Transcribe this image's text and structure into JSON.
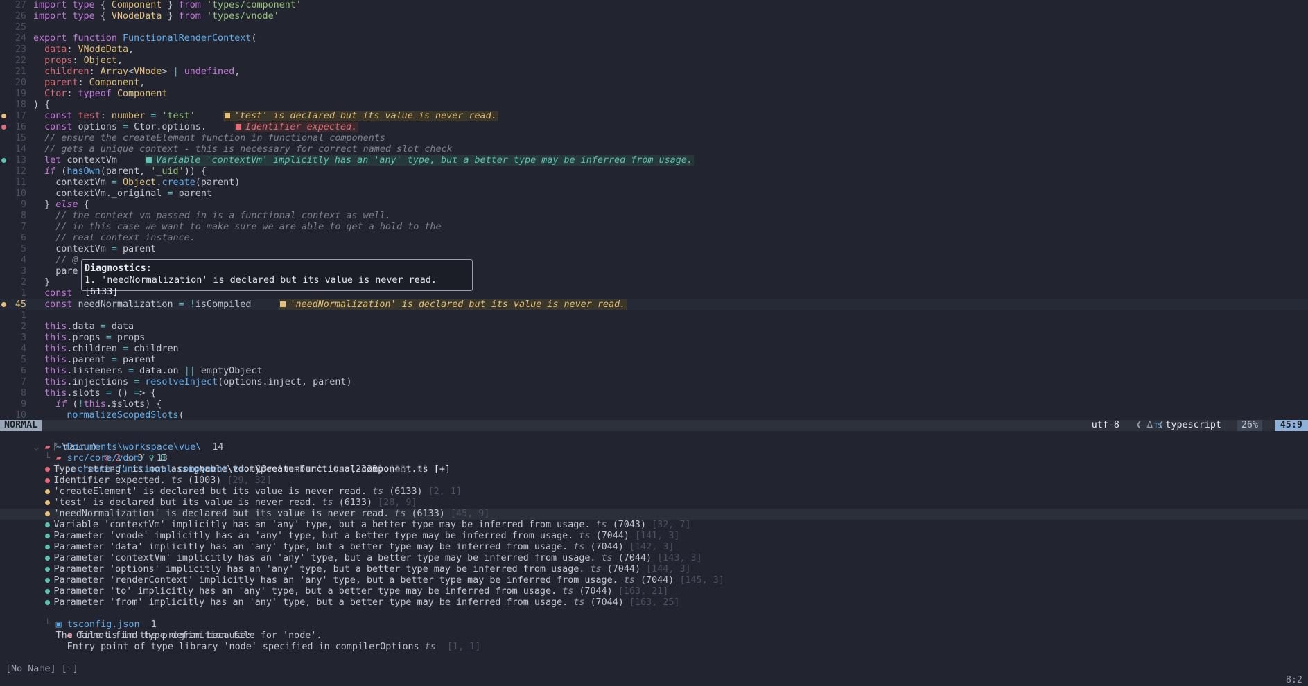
{
  "editor": {
    "lines": [
      {
        "n": "27",
        "code": "import type { Component } from 'types/component'"
      },
      {
        "n": "26",
        "code": "import type { VNodeData } from 'types/vnode'"
      },
      {
        "n": "25",
        "code": ""
      },
      {
        "n": "24",
        "code": "export function FunctionalRenderContext("
      },
      {
        "n": "23",
        "code": "  data: VNodeData,"
      },
      {
        "n": "22",
        "code": "  props: Object,"
      },
      {
        "n": "21",
        "code": "  children: Array<VNode> | undefined,"
      },
      {
        "n": "20",
        "code": "  parent: Component,"
      },
      {
        "n": "19",
        "code": "  Ctor: typeof Component"
      },
      {
        "n": "18",
        "code": ") {"
      },
      {
        "n": "17",
        "code": "  const test: number = 'test'",
        "sign": "warn",
        "virt": "'test' is declared but its value is never read.",
        "vkind": "warn"
      },
      {
        "n": "16",
        "code": "  const options = Ctor.options.",
        "sign": "err",
        "virt": "Identifier expected.",
        "vkind": "err"
      },
      {
        "n": "15",
        "code": "  // ensure the createElement function in functional components"
      },
      {
        "n": "14",
        "code": "  // gets a unique context - this is necessary for correct named slot check"
      },
      {
        "n": "13",
        "code": "  let contextVm",
        "sign": "info",
        "virt": "Variable 'contextVm' implicitly has an 'any' type, but a better type may be inferred from usage.",
        "vkind": "info"
      },
      {
        "n": "12",
        "code": "  if (hasOwn(parent, '_uid')) {"
      },
      {
        "n": "11",
        "code": "    contextVm = Object.create(parent)"
      },
      {
        "n": "10",
        "code": "    contextVm._original = parent"
      },
      {
        "n": "9",
        "code": "  } else {"
      },
      {
        "n": "8",
        "code": "    // the context vm passed in is a functional context as well."
      },
      {
        "n": "7",
        "code": "    // in this case we want to make sure we are able to get a hold to the"
      },
      {
        "n": "6",
        "code": "    // real context instance."
      },
      {
        "n": "5",
        "code": "    contextVm = parent"
      },
      {
        "n": "4",
        "code": "    // @"
      },
      {
        "n": "3",
        "code": "    pare"
      },
      {
        "n": "2",
        "code": "  }"
      },
      {
        "n": "1",
        "code": "  const"
      },
      {
        "n": "45",
        "code": "  const needNormalization = !isCompiled",
        "sign": "warn",
        "virt": "'needNormalization' is declared but its value is never read.",
        "vkind": "warn",
        "current": true
      },
      {
        "n": "1",
        "code": ""
      },
      {
        "n": "2",
        "code": "  this.data = data"
      },
      {
        "n": "3",
        "code": "  this.props = props"
      },
      {
        "n": "4",
        "code": "  this.children = children"
      },
      {
        "n": "5",
        "code": "  this.parent = parent"
      },
      {
        "n": "6",
        "code": "  this.listeners = data.on || emptyObject"
      },
      {
        "n": "7",
        "code": "  this.injections = resolveInject(options.inject, parent)"
      },
      {
        "n": "8",
        "code": "  this.slots = () => {"
      },
      {
        "n": "9",
        "code": "    if (!this.$slots) {"
      },
      {
        "n": "10",
        "code": "      normalizeScopedSlots("
      }
    ]
  },
  "hover": {
    "title": "Diagnostics:",
    "body": "1. 'needNormalization' is declared but its value is never read. [6133]"
  },
  "statusline": {
    "mode": "NORMAL",
    "branch": "main",
    "errors": "2",
    "warnings": "3",
    "hints": "8",
    "filename": "src\\core\\vdom\\create-functional-component.ts [+]",
    "encoding": "utf-8",
    "filetype": "typescript",
    "percent": "26%",
    "position": "45:9"
  },
  "trouble": {
    "root_path": "~\\Documents\\workspace\\vue\\",
    "root_count": "14",
    "dir_name": "src/core/vdom/",
    "dir_count": "13",
    "file_name": "create-functional-component.ts",
    "file_count": "13",
    "items": [
      {
        "kind": "err",
        "msg": "Type 'string' is not assignable to type 'number'.",
        "src": "ts",
        "code": "(2322)",
        "loc": "[28, 9]"
      },
      {
        "kind": "err",
        "msg": "Identifier expected.",
        "src": "ts",
        "code": "(1003)",
        "loc": "[29, 32]"
      },
      {
        "kind": "warn",
        "msg": "'createElement' is declared but its value is never read.",
        "src": "ts",
        "code": "(6133)",
        "loc": "[2, 1]"
      },
      {
        "kind": "warn",
        "msg": "'test' is declared but its value is never read.",
        "src": "ts",
        "code": "(6133)",
        "loc": "[28, 9]"
      },
      {
        "kind": "warn",
        "msg": "'needNormalization' is declared but its value is never read.",
        "src": "ts",
        "code": "(6133)",
        "loc": "[45, 9]",
        "selected": true
      },
      {
        "kind": "info",
        "msg": "Variable 'contextVm' implicitly has an 'any' type, but a better type may be inferred from usage.",
        "src": "ts",
        "code": "(7043)",
        "loc": "[32, 7]"
      },
      {
        "kind": "info",
        "msg": "Parameter 'vnode' implicitly has an 'any' type, but a better type may be inferred from usage.",
        "src": "ts",
        "code": "(7044)",
        "loc": "[141, 3]"
      },
      {
        "kind": "info",
        "msg": "Parameter 'data' implicitly has an 'any' type, but a better type may be inferred from usage.",
        "src": "ts",
        "code": "(7044)",
        "loc": "[142, 3]"
      },
      {
        "kind": "info",
        "msg": "Parameter 'contextVm' implicitly has an 'any' type, but a better type may be inferred from usage.",
        "src": "ts",
        "code": "(7044)",
        "loc": "[143, 3]"
      },
      {
        "kind": "info",
        "msg": "Parameter 'options' implicitly has an 'any' type, but a better type may be inferred from usage.",
        "src": "ts",
        "code": "(7044)",
        "loc": "[144, 3]"
      },
      {
        "kind": "info",
        "msg": "Parameter 'renderContext' implicitly has an 'any' type, but a better type may be inferred from usage.",
        "src": "ts",
        "code": "(7044)",
        "loc": "[145, 3]"
      },
      {
        "kind": "info",
        "msg": "Parameter 'to' implicitly has an 'any' type, but a better type may be inferred from usage.",
        "src": "ts",
        "code": "(7044)",
        "loc": "[163, 21]"
      },
      {
        "kind": "info",
        "msg": "Parameter 'from' implicitly has an 'any' type, but a better type may be inferred from usage.",
        "src": "ts",
        "code": "(7044)",
        "loc": "[163, 25]"
      }
    ],
    "file2_name": "tsconfig.json",
    "file2_count": "1",
    "file2_items": [
      {
        "kind": "err",
        "msg": "Cannot find type definition file for 'node'."
      }
    ],
    "file2_extra": [
      "The file is in the program because:",
      "  Entry point of type library 'node' specified in compilerOptions"
    ],
    "file2_src": "ts",
    "file2_loc": "[1, 1]"
  },
  "bottom": {
    "left": "[No Name] [-]",
    "right": "8:2"
  },
  "colors": {
    "error": "#e06c75",
    "warning": "#e5c07b",
    "info": "#5fc3b3",
    "mode_bg": "#9aa7b8",
    "position_bg": "#8fb0d8"
  }
}
